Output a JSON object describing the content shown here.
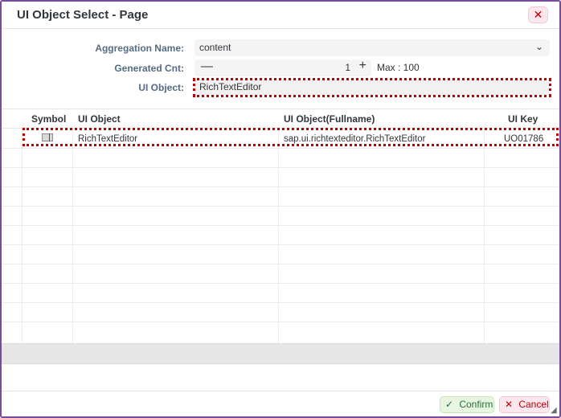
{
  "dialog": {
    "title": "UI Object Select - Page",
    "close_icon": "close-icon",
    "close_glyph": "✕"
  },
  "form": {
    "aggregation_label": "Aggregation Name:",
    "aggregation_value": "content",
    "generated_label": "Generated Cnt:",
    "generated_value": "1",
    "max_label": "Max : 100",
    "uiobject_label": "UI Object:",
    "uiobject_value": "RichTextEditor",
    "minus_glyph": "—",
    "plus_glyph": "+",
    "chevron_glyph": "⌄"
  },
  "table": {
    "columns": [
      "Symbol",
      "UI Object",
      "UI Object(Fullname)",
      "UI Key"
    ],
    "rows": [
      {
        "symbol_icon": "richtext-symbol-icon",
        "ui_object": "RichTextEditor",
        "fullname": "sap.ui.richtexteditor.RichTextEditor",
        "key": "UO01786"
      }
    ]
  },
  "footer": {
    "confirm_label": "Confirm",
    "cancel_label": "Cancel",
    "confirm_glyph": "✓",
    "cancel_glyph": "✕"
  },
  "colors": {
    "border": "#7a4a9c",
    "highlight": "#c00000",
    "confirm": "#256f3a",
    "cancel": "#bb0000"
  }
}
